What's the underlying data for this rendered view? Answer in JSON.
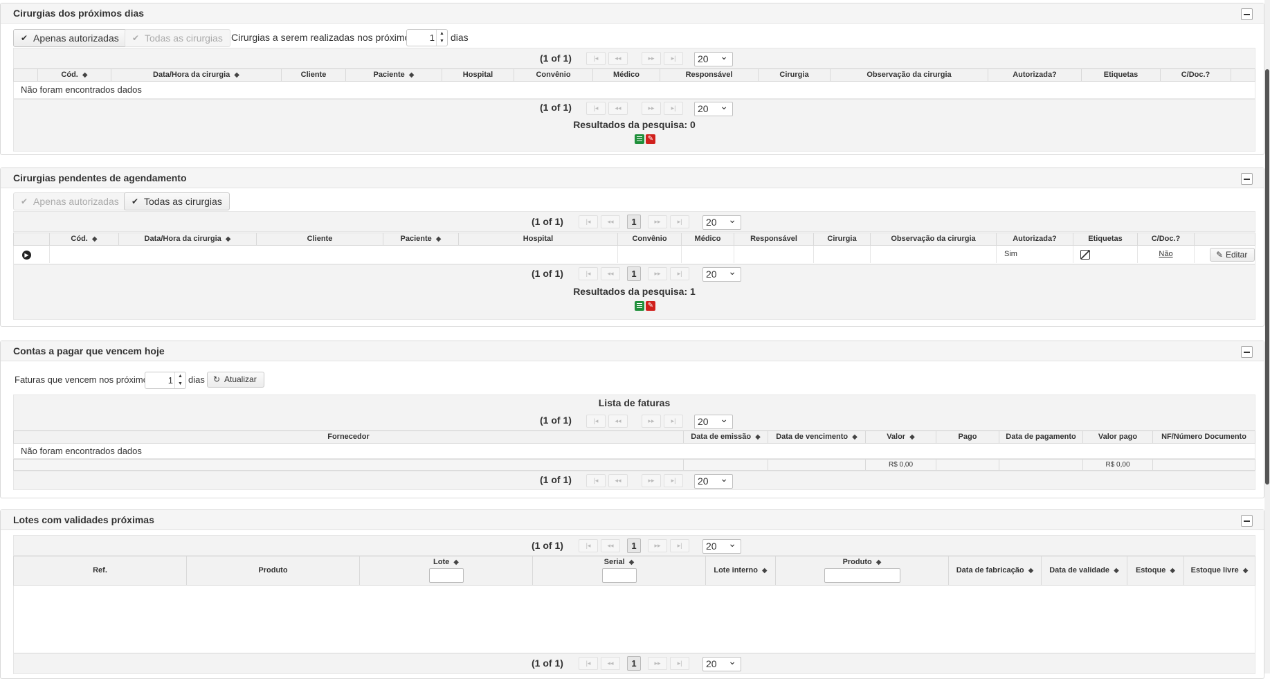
{
  "section1": {
    "title": "Cirurgias dos próximos dias",
    "btn_authorized": "Apenas autorizadas",
    "btn_all": "Todas as cirurgias",
    "days_prefix": "Cirurgias a serem realizadas nos próximos",
    "days_value": "1",
    "days_suffix": "dias",
    "pager": "(1 of 1)",
    "page_size": "20",
    "columns": [
      "Cód.",
      "Data/Hora da cirurgia",
      "Cliente",
      "Paciente",
      "Hospital",
      "Convênio",
      "Médico",
      "Responsável",
      "Cirurgia",
      "Observação da cirurgia",
      "Autorizada?",
      "Etiquetas",
      "C/Doc.?"
    ],
    "empty_message": "Não foram encontrados dados",
    "results": "Resultados da pesquisa: 0"
  },
  "section2": {
    "title": "Cirurgias pendentes de agendamento",
    "btn_authorized": "Apenas autorizadas",
    "btn_all": "Todas as cirurgias",
    "pager": "(1 of 1)",
    "page_number": "1",
    "page_size": "20",
    "columns": [
      "Cód.",
      "Data/Hora da cirurgia",
      "Cliente",
      "Paciente",
      "Hospital",
      "Convênio",
      "Médico",
      "Responsável",
      "Cirurgia",
      "Observação da cirurgia",
      "Autorizada?",
      "Etiquetas",
      "C/Doc.?"
    ],
    "row": {
      "autorizada": "Sim",
      "cdoc": "Não",
      "edit_label": "Editar"
    },
    "results": "Resultados da pesquisa: 1"
  },
  "section3": {
    "title": "Contas a pagar que vencem hoje",
    "days_prefix": "Faturas que vencem nos próximos",
    "days_value": "1",
    "days_suffix": "dias",
    "refresh_label": "Atualizar",
    "list_title": "Lista de faturas",
    "pager": "(1 of 1)",
    "page_size": "20",
    "columns": [
      "Fornecedor",
      "Data de emissão",
      "Data de vencimento",
      "Valor",
      "Pago",
      "Data de pagamento",
      "Valor pago",
      "NF/Número Documento"
    ],
    "empty_message": "Não foram encontrados dados",
    "total_valor": "R$ 0,00",
    "total_valor_pago": "R$ 0,00"
  },
  "section4": {
    "title": "Lotes com validades próximas",
    "pager": "(1 of 1)",
    "page_number": "1",
    "page_size": "20",
    "columns": [
      "Ref.",
      "Produto",
      "Lote",
      "Serial",
      "Lote interno",
      "Produto",
      "Data de fabricação",
      "Data de validade",
      "Estoque",
      "Estoque livre"
    ]
  },
  "icons": {
    "check": "check-icon",
    "first": "first-page-icon",
    "prev": "prev-page-icon",
    "next": "next-page-icon",
    "last": "last-page-icon",
    "sort": "sort-icon",
    "excel": "excel-icon",
    "pdf": "pdf-icon",
    "expand": "row-expand-icon",
    "pencil": "pencil-icon",
    "refresh": "refresh-icon"
  }
}
